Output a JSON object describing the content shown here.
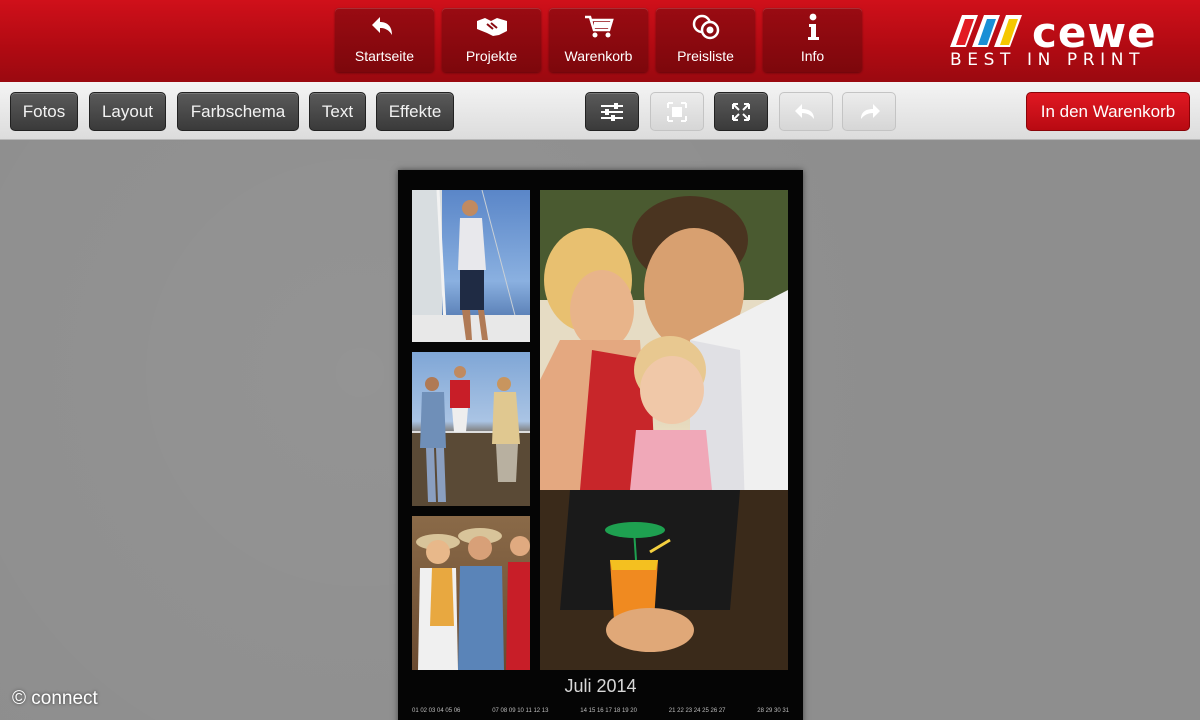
{
  "header": {
    "nav": [
      {
        "label": "Startseite",
        "icon": "undo-arrow-icon"
      },
      {
        "label": "Projekte",
        "icon": "handshake-icon"
      },
      {
        "label": "Warenkorb",
        "icon": "shopping-cart-icon"
      },
      {
        "label": "Preisliste",
        "icon": "coins-icon"
      },
      {
        "label": "Info",
        "icon": "info-icon"
      }
    ],
    "logo": {
      "word": "cewe",
      "tagline": "BEST IN PRINT"
    },
    "brand_color": "#c00d16"
  },
  "toolbar": {
    "tabs": [
      "Fotos",
      "Layout",
      "Farbschema",
      "Text",
      "Effekte"
    ],
    "icons": [
      "adjust-sliders-icon",
      "crop-frame-icon",
      "fullscreen-icon",
      "undo-icon",
      "redo-icon"
    ],
    "cart_button": "In den Warenkorb"
  },
  "poster": {
    "month": "Juli 2014",
    "calendar_days": [
      "01 02 03 04 05 06",
      "07 08 09 10 11 12 13",
      "14 15 16 17 18 19 20",
      "21 22 23 24 25 26 27",
      "28 29 30 31"
    ]
  },
  "watermark": "© connect"
}
